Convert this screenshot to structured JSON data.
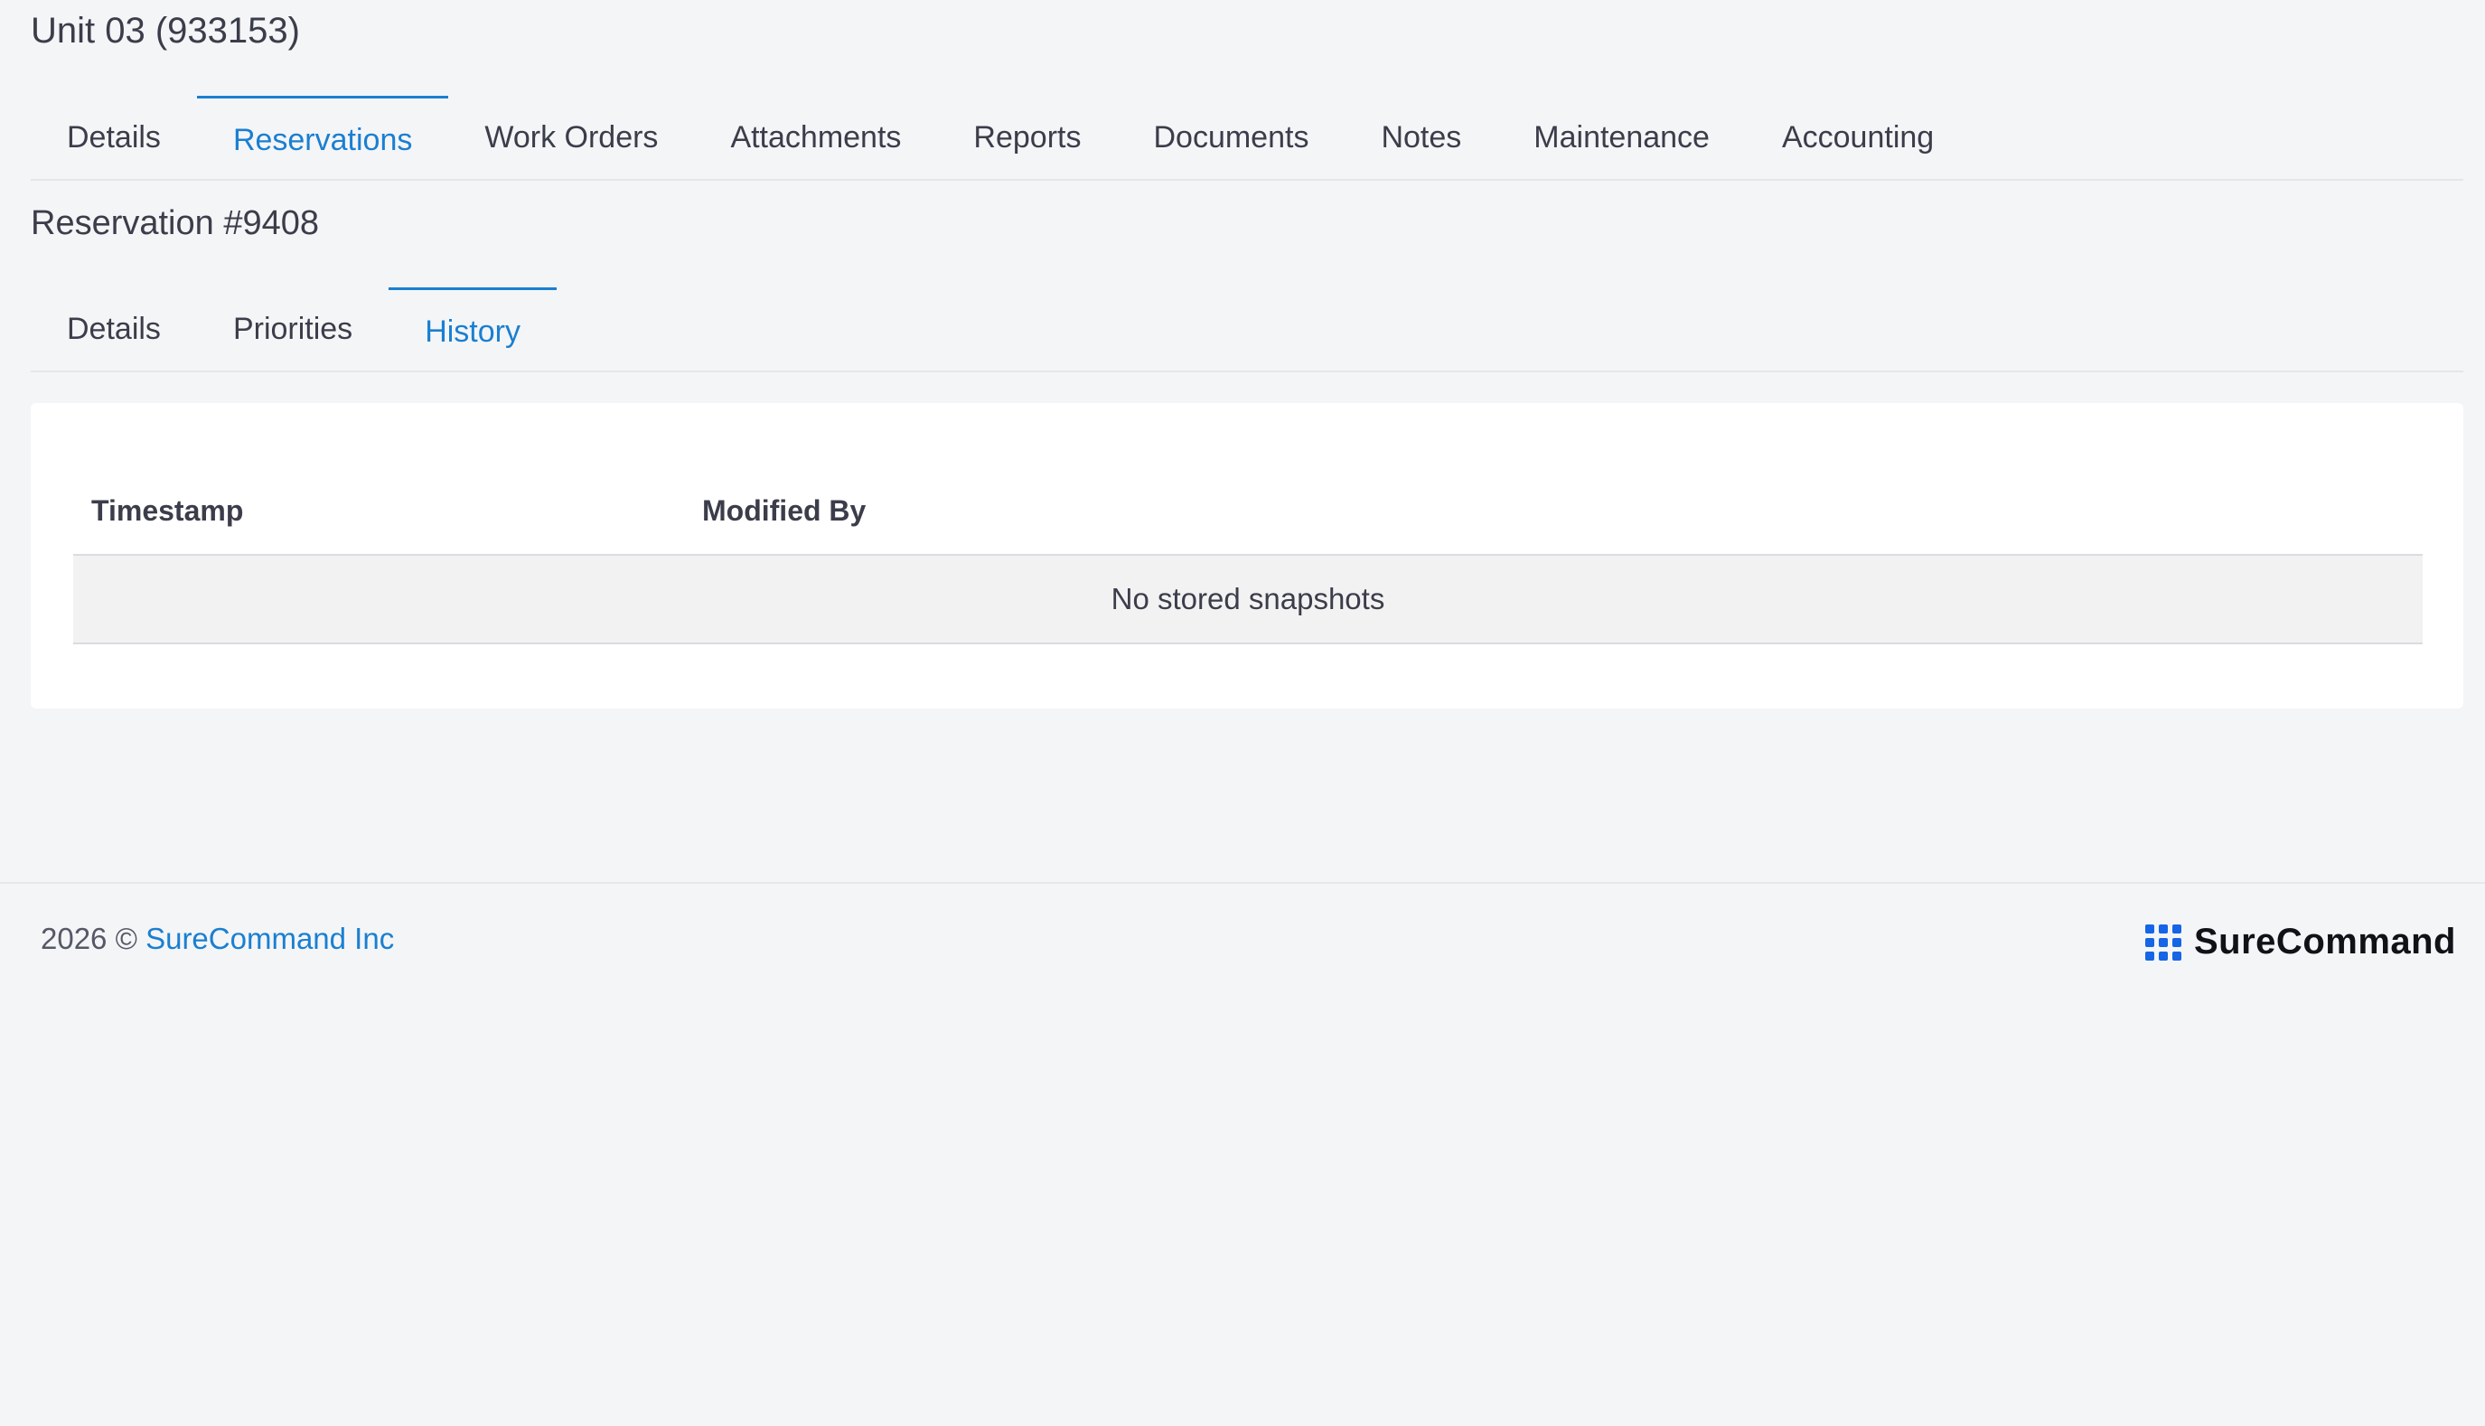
{
  "header": {
    "title": "Unit 03 (933153)"
  },
  "main_tabs": [
    {
      "label": "Details",
      "active": false
    },
    {
      "label": "Reservations",
      "active": true
    },
    {
      "label": "Work Orders",
      "active": false
    },
    {
      "label": "Attachments",
      "active": false
    },
    {
      "label": "Reports",
      "active": false
    },
    {
      "label": "Documents",
      "active": false
    },
    {
      "label": "Notes",
      "active": false
    },
    {
      "label": "Maintenance",
      "active": false
    },
    {
      "label": "Accounting",
      "active": false
    }
  ],
  "reservation": {
    "title": "Reservation #9408",
    "tabs": [
      {
        "label": "Details",
        "active": false
      },
      {
        "label": "Priorities",
        "active": false
      },
      {
        "label": "History",
        "active": true
      }
    ]
  },
  "history_table": {
    "columns": [
      "Timestamp",
      "Modified By"
    ],
    "empty_message": "No stored snapshots"
  },
  "footer": {
    "copyright_prefix": "2026 ©",
    "company_link": "SureCommand Inc",
    "brand_name": "SureCommand",
    "brand_icon": "grid-icon"
  },
  "colors": {
    "accent": "#1a7fd1",
    "brand_icon": "#1565e6",
    "background": "#f4f5f7"
  }
}
